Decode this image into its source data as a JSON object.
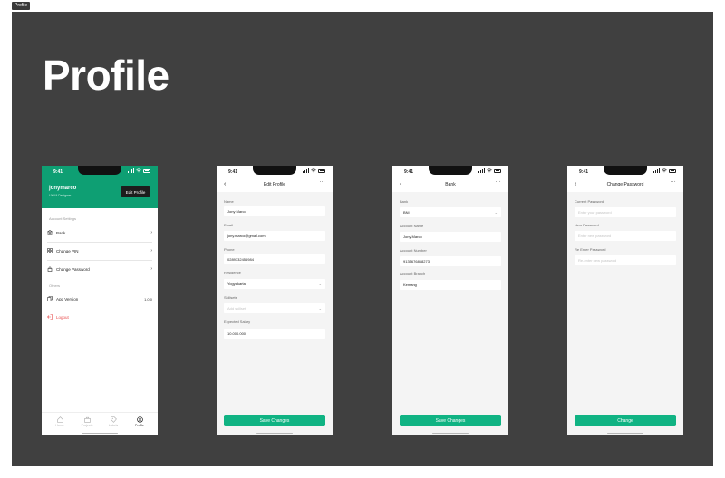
{
  "frame_tag": "Profile",
  "page_title": "Profile",
  "status_time": "9:41",
  "profile": {
    "name": "jonymarco",
    "role": "UX/UI Designer",
    "edit_button": "Edit Profile",
    "account_settings_label": "Account Settings",
    "menu": [
      {
        "label": "Bank",
        "icon": "bank-icon"
      },
      {
        "label": "Change PIN",
        "icon": "grid-icon"
      },
      {
        "label": "Change Password",
        "icon": "lock-icon"
      }
    ],
    "others_label": "Others",
    "app_version_label": "App Version",
    "app_version_value": "1.0.0",
    "logout_label": "Logout",
    "tabs": [
      "Home",
      "Projects",
      "Labels",
      "Profile"
    ],
    "active_tab": "Profile"
  },
  "edit_profile": {
    "title": "Edit Profile",
    "fields": [
      {
        "label": "Name",
        "value": "Jony Marco",
        "placeholder": ""
      },
      {
        "label": "Email",
        "value": "jony.marco@gmail.com",
        "placeholder": ""
      },
      {
        "label": "Phone",
        "value": "0289332456984",
        "placeholder": ""
      },
      {
        "label": "Residence",
        "value": "Yogyakarta",
        "placeholder": ""
      },
      {
        "label": "Skillsets",
        "value": "",
        "placeholder": "Add skillset"
      },
      {
        "label": "Expected Salary",
        "value": "10.000.000",
        "placeholder": ""
      }
    ],
    "save_label": "Save Changes"
  },
  "bank": {
    "title": "Bank",
    "fields": [
      {
        "label": "Bank",
        "value": "BNI"
      },
      {
        "label": "Account Name",
        "value": "Jony Marco"
      },
      {
        "label": "Account Number",
        "value": "9135676868273"
      },
      {
        "label": "Account Branch",
        "value": "Kemang"
      }
    ],
    "save_label": "Save Changes"
  },
  "change_password": {
    "title": "Change Password",
    "fields": [
      {
        "label": "Current Password",
        "placeholder": "Enter your password"
      },
      {
        "label": "New Password",
        "placeholder": "Enter new password"
      },
      {
        "label": "Re Enter Password",
        "placeholder": "Re-enter new password"
      }
    ],
    "change_label": "Change"
  },
  "colors": {
    "canvas": "#404040",
    "brand_green": "#0e9f73",
    "button_green": "#10b383",
    "logout_red": "#e84c4c"
  }
}
